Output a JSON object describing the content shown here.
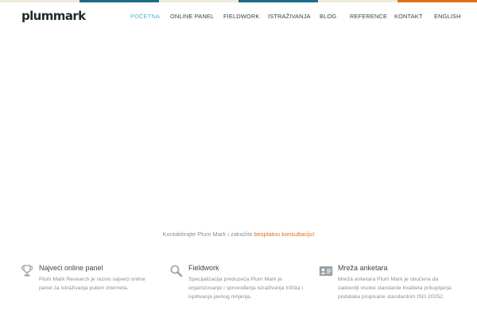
{
  "brand": {
    "logo": "plummark"
  },
  "top_strip": [
    "#f0ead9",
    "#1b6b89",
    "#f0ead9",
    "#1b6b89",
    "#f0ead9",
    "#e0701f"
  ],
  "nav": {
    "items": [
      {
        "label": "POČETNA",
        "active": true
      },
      {
        "label": "ONLINE PANEL",
        "active": false
      },
      {
        "label": "FIELDWORK",
        "active": false
      },
      {
        "label": "ISTRAŽIVANJA",
        "active": false
      },
      {
        "label": "BLOG",
        "active": false
      },
      {
        "label": "REFERENCE",
        "active": false
      },
      {
        "label": "KONTAKT",
        "active": false
      },
      {
        "label": "ENGLISH",
        "active": false
      }
    ]
  },
  "cta": {
    "text": "Kontaktirajte Plum Mark i zakažite ",
    "link": "besplatnu konsultaciju!"
  },
  "features": [
    {
      "icon": "trophy-icon",
      "title": "Najveći online panel",
      "description": "Plum Mark Research je razvio najveći online panel za istraživanja putem interneta."
    },
    {
      "icon": "magnifier-icon",
      "title": "Fieldwork",
      "description": "Specijalizacija preduzeća Plum Mark je organizovanje i sprovođenja istraživanja tržišta i ispitivanja javnog mnjenja."
    },
    {
      "icon": "id-card-icon",
      "title": "Mreža anketara",
      "description": "Mreža anketara Plum Mark je obučena da zadovolji visoke standarde kvaliteta prikupljanja podataka propisane standardom ISO 20252."
    }
  ]
}
